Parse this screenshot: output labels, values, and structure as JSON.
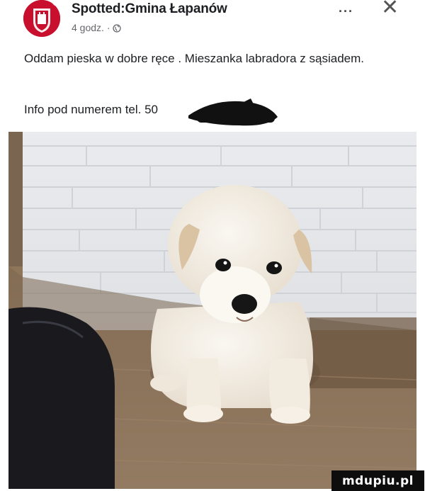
{
  "post": {
    "page_name": "Spotted:Gmina Łapanów",
    "time": "4 godz. ·",
    "more_label": "···",
    "close_label": "✕",
    "text": "Oddam pieska w dobre ręce . Mieszanka labradora z sąsiadem.",
    "info": "Info pod numerem tel. 50"
  },
  "icons": {
    "avatar": "coat-of-arms-icon",
    "audience": "globe-icon",
    "more": "more-options-icon",
    "close": "close-icon"
  },
  "colors": {
    "avatar_bg": "#c8102e",
    "meta_text": "#65676b",
    "body_text": "#1c1e21",
    "watermark_bg": "#0d0d0d"
  },
  "watermark": {
    "text": "mdupiu.pl"
  }
}
